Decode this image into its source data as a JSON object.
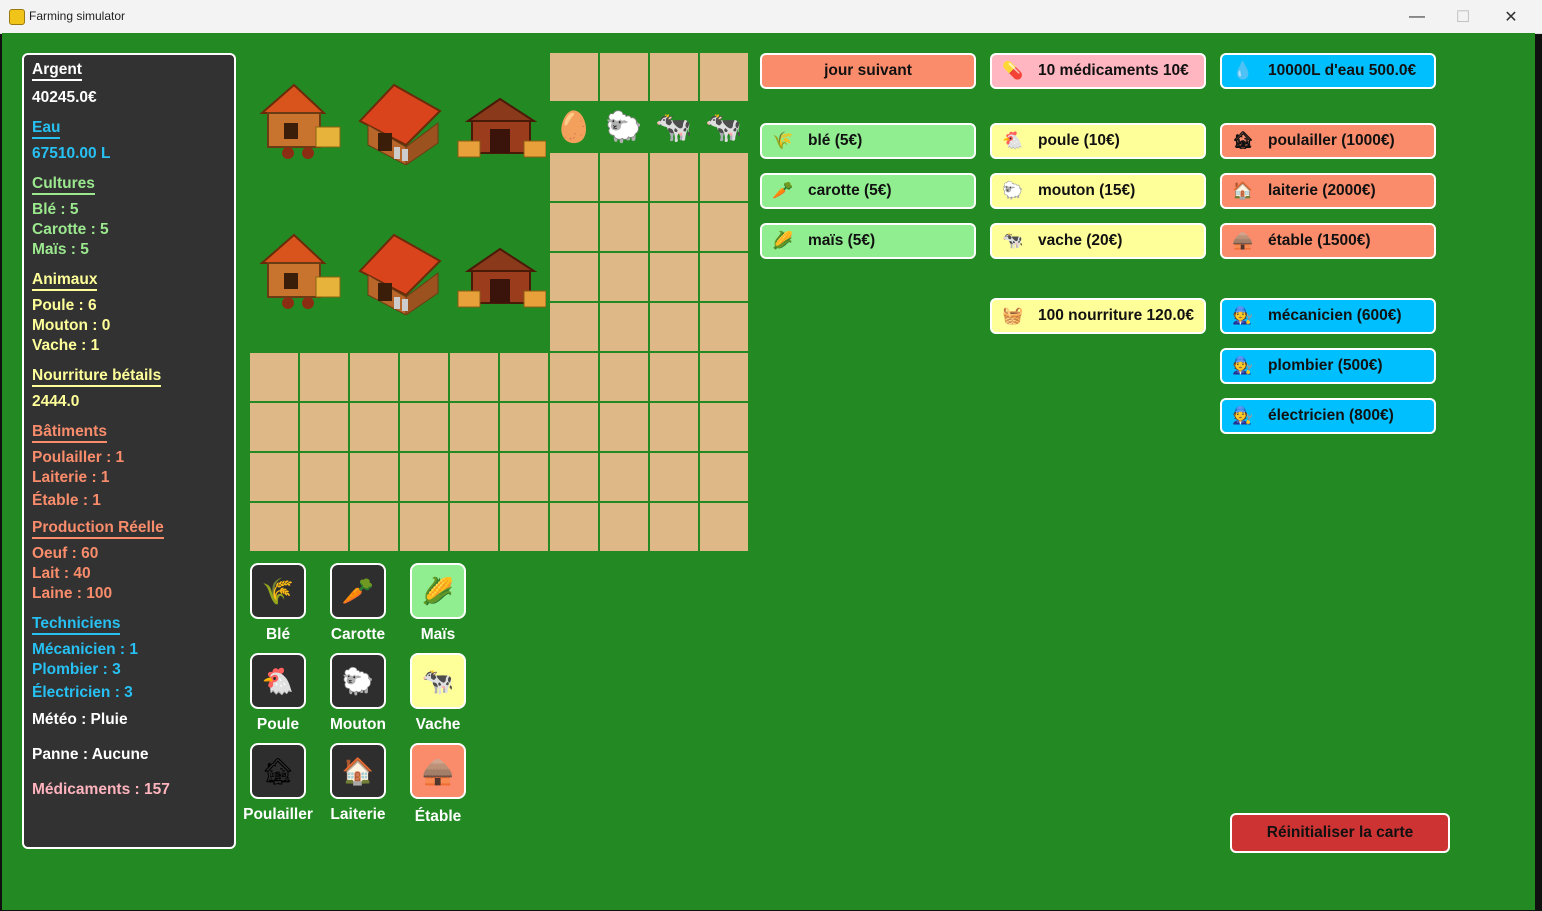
{
  "window": {
    "title": "Farming simulator",
    "minimize": "—",
    "maximize": "☐",
    "close": "✕"
  },
  "colors": {
    "background": "#238a23",
    "panel": "#323232",
    "tile": "#deb887",
    "salmon": "#fa8c6b",
    "light_green": "#90ee90",
    "light_yellow": "#ffff99",
    "pink": "#ffb6c1",
    "sky": "#00bfff",
    "red": "#cd3333"
  },
  "stats": {
    "argent_label": "Argent",
    "argent_value": "40245.0€",
    "eau_label": "Eau",
    "eau_value": "67510.00 L",
    "cultures_label": "Cultures",
    "cultures": [
      "Blé : 5",
      "Carotte : 5",
      "Maïs : 5"
    ],
    "animaux_label": "Animaux",
    "animaux": [
      "Poule : 6",
      "Mouton : 0",
      "Vache : 1"
    ],
    "nourriture_label": "Nourriture bétails",
    "nourriture_value": "2444.0",
    "batiments_label": "Bâtiments",
    "batiments": [
      "Poulailler : 1",
      "Laiterie : 1",
      "Étable : 1"
    ],
    "production_label": "Production Réelle",
    "production": [
      "Oeuf : 60",
      "Lait : 40",
      "Laine : 100"
    ],
    "techniciens_label": "Techniciens",
    "techniciens": [
      "Mécanicien : 1",
      "Plombier : 3",
      "Électricien : 3"
    ],
    "meteo": "Météo : Pluie",
    "panne": "Panne : Aucune",
    "medicaments": "Médicaments : 157"
  },
  "grid": {
    "products": [
      {
        "name": "egg-icon",
        "glyph": "🥚"
      },
      {
        "name": "sheep-icon",
        "glyph": "🐑"
      },
      {
        "name": "cow-icon",
        "glyph": "🐄"
      },
      {
        "name": "cow-icon",
        "glyph": "🐄"
      }
    ],
    "buildings": [
      "chicken-coop",
      "dairy",
      "barn",
      "chicken-coop",
      "dairy",
      "barn"
    ]
  },
  "actions": {
    "next_day": "jour suivant",
    "medicine": {
      "label": "10 médicaments 10€",
      "icon": "pill-icon",
      "glyph": "💊"
    },
    "water": {
      "label": "10000L d'eau 500.0€",
      "icon": "water-drop-icon",
      "glyph": "💧"
    },
    "food": {
      "label": "100 nourriture 120.0€",
      "icon": "feed-sack-icon",
      "glyph": "🧺"
    },
    "reset": "Réinitialiser la carte"
  },
  "shop": {
    "crops": [
      {
        "label": "blé (5€)",
        "icon": "wheat-icon",
        "glyph": "🌾"
      },
      {
        "label": "carotte (5€)",
        "icon": "carrot-icon",
        "glyph": "🥕"
      },
      {
        "label": "maïs (5€)",
        "icon": "corn-icon",
        "glyph": "🌽"
      }
    ],
    "animals": [
      {
        "label": "poule (10€)",
        "icon": "chicken-icon",
        "glyph": "🐔"
      },
      {
        "label": "mouton (15€)",
        "icon": "sheep-icon",
        "glyph": "🐑"
      },
      {
        "label": "vache (20€)",
        "icon": "cow-icon",
        "glyph": "🐄"
      }
    ],
    "buildings": [
      {
        "label": "poulailler (1000€)",
        "icon": "chicken-coop-icon",
        "glyph": "🏚"
      },
      {
        "label": "laiterie (2000€)",
        "icon": "dairy-icon",
        "glyph": "🏠"
      },
      {
        "label": "étable (1500€)",
        "icon": "barn-icon",
        "glyph": "🛖"
      }
    ],
    "technicians": [
      {
        "label": "mécanicien (600€)",
        "icon": "mechanic-icon",
        "glyph": "🧑‍🔧"
      },
      {
        "label": "plombier (500€)",
        "icon": "plumber-icon",
        "glyph": "🧑‍🔧"
      },
      {
        "label": "électricien (800€)",
        "icon": "electrician-icon",
        "glyph": "🧑‍🔧"
      }
    ]
  },
  "selector": {
    "items": [
      {
        "label": "Blé",
        "icon": "wheat-icon",
        "glyph": "🌾",
        "selected": false
      },
      {
        "label": "Carotte",
        "icon": "carrot-icon",
        "glyph": "🥕",
        "selected": false
      },
      {
        "label": "Maïs",
        "icon": "corn-icon",
        "glyph": "🌽",
        "selected": true
      },
      {
        "label": "Poule",
        "icon": "chicken-icon",
        "glyph": "🐔",
        "selected": false
      },
      {
        "label": "Mouton",
        "icon": "sheep-icon",
        "glyph": "🐑",
        "selected": false
      },
      {
        "label": "Vache",
        "icon": "cow-icon",
        "glyph": "🐄",
        "selected": true
      },
      {
        "label": "Poulailler",
        "icon": "chicken-coop-icon",
        "glyph": "🏚",
        "selected": false
      },
      {
        "label": "Laiterie",
        "icon": "dairy-icon",
        "glyph": "🏠",
        "selected": false
      },
      {
        "label": "Étable",
        "icon": "barn-icon",
        "glyph": "🛖",
        "selected": true
      }
    ]
  }
}
